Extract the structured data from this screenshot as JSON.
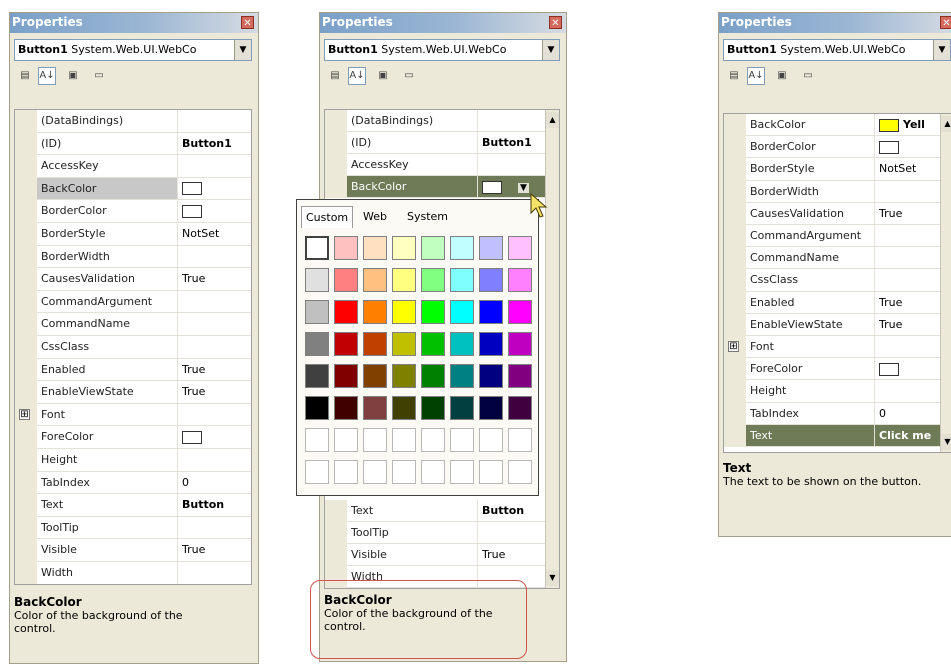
{
  "panel_title": "Properties",
  "close_glyph": "✕",
  "object_selector": {
    "name": "Button1",
    "type": "System.Web.UI.WebCo",
    "dropdown": "▼"
  },
  "toolbar_icons": [
    "categorized-icon",
    "alphabetical-icon",
    "properties-icon",
    "events-icon"
  ],
  "left": {
    "rows": [
      {
        "name": "(DataBindings)",
        "value": ""
      },
      {
        "name": "(ID)",
        "value": "Button1",
        "bold": true
      },
      {
        "name": "AccessKey",
        "value": ""
      },
      {
        "name": "BackColor",
        "value": "",
        "swatch": "#ffffff",
        "grey": true
      },
      {
        "name": "BorderColor",
        "value": "",
        "swatch": "#ffffff"
      },
      {
        "name": "BorderStyle",
        "value": "NotSet"
      },
      {
        "name": "BorderWidth",
        "value": ""
      },
      {
        "name": "CausesValidation",
        "value": "True"
      },
      {
        "name": "CommandArgument",
        "value": ""
      },
      {
        "name": "CommandName",
        "value": ""
      },
      {
        "name": "CssClass",
        "value": ""
      },
      {
        "name": "Enabled",
        "value": "True"
      },
      {
        "name": "EnableViewState",
        "value": "True"
      },
      {
        "name": "Font",
        "value": "",
        "expand": "⊞"
      },
      {
        "name": "ForeColor",
        "value": "",
        "swatch": "#ffffff"
      },
      {
        "name": "Height",
        "value": ""
      },
      {
        "name": "TabIndex",
        "value": "0"
      },
      {
        "name": "Text",
        "value": "Button",
        "bold": true
      },
      {
        "name": "ToolTip",
        "value": ""
      },
      {
        "name": "Visible",
        "value": "True"
      },
      {
        "name": "Width",
        "value": ""
      }
    ],
    "desc_title": "BackColor",
    "desc_text": "Color of the background of the control."
  },
  "middle": {
    "rows_top": [
      {
        "name": "(DataBindings)",
        "value": ""
      },
      {
        "name": "(ID)",
        "value": "Button1",
        "bold": true
      },
      {
        "name": "AccessKey",
        "value": ""
      },
      {
        "name": "BackColor",
        "value": "",
        "swatch": "#ffffff",
        "selected": true
      }
    ],
    "rows_bottom": [
      {
        "name": "Text",
        "value": "Button",
        "bold": true
      },
      {
        "name": "ToolTip",
        "value": ""
      },
      {
        "name": "Visible",
        "value": "True"
      },
      {
        "name": "Width",
        "value": ""
      }
    ],
    "desc_title": "BackColor",
    "desc_text": "Color of the background of the control.",
    "popup_tabs": [
      "Custom",
      "Web",
      "System"
    ],
    "palette": [
      [
        "#ffffff",
        "#ffc0c0",
        "#ffe0c0",
        "#ffffc0",
        "#c0ffc0",
        "#c0ffff",
        "#c0c0ff",
        "#ffc0ff"
      ],
      [
        "#e0e0e0",
        "#ff8080",
        "#ffc080",
        "#ffff80",
        "#80ff80",
        "#80ffff",
        "#8080ff",
        "#ff80ff"
      ],
      [
        "#c0c0c0",
        "#ff0000",
        "#ff8000",
        "#ffff00",
        "#00ff00",
        "#00ffff",
        "#0000ff",
        "#ff00ff"
      ],
      [
        "#808080",
        "#c00000",
        "#c04000",
        "#c0c000",
        "#00c000",
        "#00c0c0",
        "#0000c0",
        "#c000c0"
      ],
      [
        "#404040",
        "#800000",
        "#804000",
        "#808000",
        "#008000",
        "#008080",
        "#000080",
        "#800080"
      ],
      [
        "#000000",
        "#400000",
        "#804040",
        "#404000",
        "#004000",
        "#004040",
        "#000040",
        "#400040"
      ],
      [
        "#ffffff",
        "#ffffff",
        "#ffffff",
        "#ffffff",
        "#ffffff",
        "#ffffff",
        "#ffffff",
        "#ffffff"
      ],
      [
        "#ffffff",
        "#ffffff",
        "#ffffff",
        "#ffffff",
        "#ffffff",
        "#ffffff",
        "#ffffff",
        "#ffffff"
      ]
    ]
  },
  "right": {
    "rows": [
      {
        "name": "BackColor",
        "value": "Yell",
        "swatch": "#ffff00",
        "bold": true
      },
      {
        "name": "BorderColor",
        "value": "",
        "swatch": "#ffffff"
      },
      {
        "name": "BorderStyle",
        "value": "NotSet"
      },
      {
        "name": "BorderWidth",
        "value": ""
      },
      {
        "name": "CausesValidation",
        "value": "True"
      },
      {
        "name": "CommandArgument",
        "value": ""
      },
      {
        "name": "CommandName",
        "value": ""
      },
      {
        "name": "CssClass",
        "value": ""
      },
      {
        "name": "Enabled",
        "value": "True"
      },
      {
        "name": "EnableViewState",
        "value": "True"
      },
      {
        "name": "Font",
        "value": "",
        "expand": "⊞"
      },
      {
        "name": "ForeColor",
        "value": "",
        "swatch": "#ffffff"
      },
      {
        "name": "Height",
        "value": ""
      },
      {
        "name": "TabIndex",
        "value": "0"
      },
      {
        "name": "Text",
        "value": "Click me",
        "bold": true,
        "selected": true
      }
    ],
    "desc_title": "Text",
    "desc_text": "The text to be shown on the button."
  },
  "scroll_up": "▲",
  "scroll_down": "▼"
}
